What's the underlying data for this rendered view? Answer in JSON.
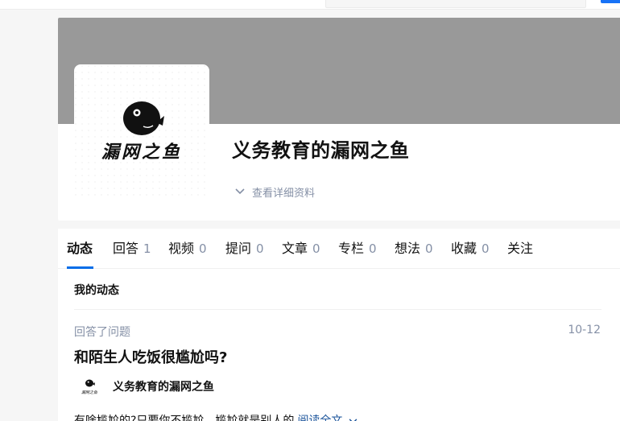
{
  "colors": {
    "accent": "#056de8",
    "cover": "#999999",
    "muted_text": "#8590a6",
    "link": "#175199",
    "brand_button": "#1772f6"
  },
  "profile": {
    "name": "义务教育的漏网之鱼",
    "avatar_text": "漏网之鱼",
    "detail_toggle_label": "查看详细资料",
    "detail_toggle_icon": "chevron-down-icon"
  },
  "tabs": [
    {
      "label": "动态",
      "count": null,
      "active": true
    },
    {
      "label": "回答",
      "count": "1"
    },
    {
      "label": "视频",
      "count": "0"
    },
    {
      "label": "提问",
      "count": "0"
    },
    {
      "label": "文章",
      "count": "0"
    },
    {
      "label": "专栏",
      "count": "0"
    },
    {
      "label": "想法",
      "count": "0"
    },
    {
      "label": "收藏",
      "count": "0"
    },
    {
      "label": "关注",
      "count": null
    }
  ],
  "feed": {
    "section_title": "我的动态",
    "items": [
      {
        "action": "回答了问题",
        "date": "10-12",
        "question_title": "和陌生人吃饭很尴尬吗?",
        "author_name": "义务教育的漏网之鱼",
        "author_avatar_text": "漏网之鱼",
        "excerpt": "有啥尴尬的?只要你不尴尬，尴尬就是别人的",
        "read_more_label": "阅读全文",
        "read_more_icon": "chevron-down-icon"
      }
    ]
  }
}
